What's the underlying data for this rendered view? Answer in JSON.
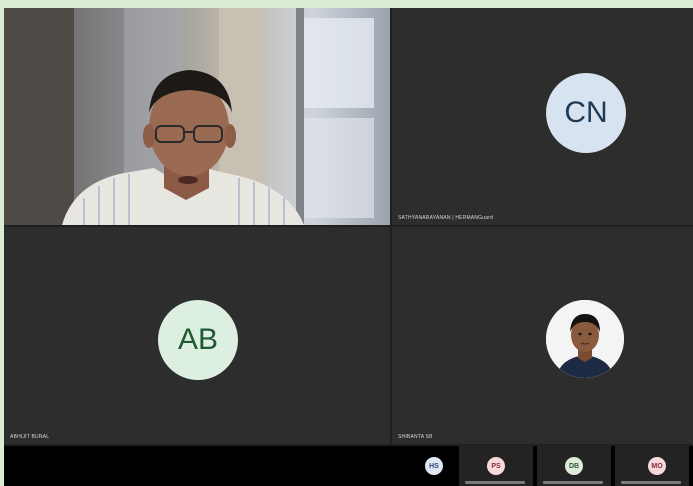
{
  "participants": {
    "cn": {
      "initials": "CN",
      "name": "SATHYANARAYANAN | HERMANGuard"
    },
    "ab": {
      "initials": "AB",
      "name": "ABHIJIT BURAL"
    },
    "sb": {
      "name": "SHIBANTA SB"
    }
  },
  "strip": [
    {
      "initials": "HS",
      "bg": "#dfe7f2",
      "fg": "#2a4a6e"
    },
    {
      "initials": "PS",
      "bg": "#f5d9dd",
      "fg": "#8a2a3a"
    },
    {
      "initials": "DB",
      "bg": "#dcecd9",
      "fg": "#2d5a2f"
    },
    {
      "initials": "MO",
      "bg": "#f5d9dd",
      "fg": "#8a2a3a"
    }
  ]
}
